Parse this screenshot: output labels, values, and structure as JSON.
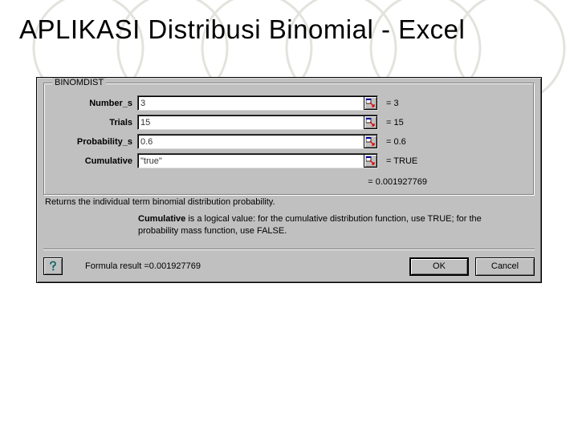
{
  "slide": {
    "title": "APLIKASI Distribusi Binomial - Excel"
  },
  "dialog": {
    "function_name": "BINOMDIST",
    "params": [
      {
        "label": "Number_s",
        "value": "3",
        "equals": "= 3"
      },
      {
        "label": "Trials",
        "value": "15",
        "equals": "= 15"
      },
      {
        "label": "Probability_s",
        "value": "0.6",
        "equals": "= 0.6"
      },
      {
        "label": "Cumulative",
        "value": "\"true\"",
        "equals": "= TRUE"
      }
    ],
    "result_equals": "= 0.001927769",
    "description": "Returns the individual term binomial distribution probability.",
    "arg_help_name": "Cumulative",
    "arg_help_text": "is a logical value: for the cumulative distribution function, use TRUE; for the probability mass function, use FALSE.",
    "formula_result_label": "Formula result =",
    "formula_result_value": "0.001927769",
    "ok_label": "OK",
    "cancel_label": "Cancel"
  }
}
